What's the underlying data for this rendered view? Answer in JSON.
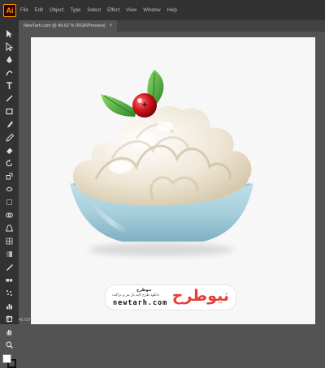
{
  "app": {
    "logo_text": "Ai"
  },
  "menu": {
    "items": [
      "File",
      "Edit",
      "Object",
      "Type",
      "Select",
      "Effect",
      "View",
      "Window",
      "Help"
    ]
  },
  "document_tab": {
    "title": "NewTarh.com @ 46.62 % (RGB/Preview)",
    "close_glyph": "×"
  },
  "status": {
    "zoom": "46.62%"
  },
  "toolbar": {
    "tools": [
      "selection-tool",
      "direct-selection-tool",
      "pen-tool",
      "curvature-tool",
      "type-tool",
      "line-tool",
      "rectangle-tool",
      "paintbrush-tool",
      "pencil-tool",
      "eraser-tool",
      "rotate-tool",
      "scale-tool",
      "width-tool",
      "free-transform-tool",
      "shape-builder-tool",
      "perspective-tool",
      "mesh-tool",
      "gradient-tool",
      "eyedropper-tool",
      "blend-tool",
      "symbol-sprayer-tool",
      "graph-tool",
      "artboard-tool",
      "hand-tool",
      "zoom-tool"
    ]
  },
  "colors": {
    "fill": "#ffffff",
    "stroke": "#111111",
    "accent": "#ff9a00",
    "brand_red": "#e53e36"
  },
  "watermark": {
    "brand": "نیوطرح",
    "name": "نیوطرح",
    "tagline": "دانلود طرح لایه باز بنر و تراکت",
    "url": "newtarh.com"
  },
  "artwork": {
    "subject": "whipped cream dessert in glass bowl with cranberry and mint leaves"
  }
}
